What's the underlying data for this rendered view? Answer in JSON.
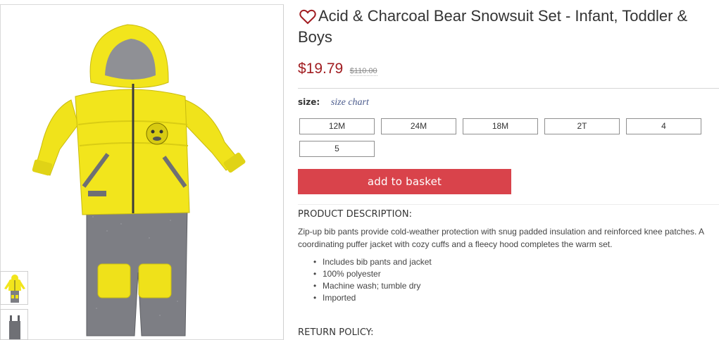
{
  "product": {
    "title": "Acid & Charcoal Bear Snowsuit Set - Infant, Toddler & Boys",
    "price": "$19.79",
    "original_price": "$110.00"
  },
  "size_selector": {
    "label": "size:",
    "chart_link": "size chart",
    "options": [
      "12M",
      "24M",
      "18M",
      "2T",
      "4",
      "5"
    ]
  },
  "actions": {
    "add_to_basket": "add to basket"
  },
  "description": {
    "heading": "PRODUCT DESCRIPTION:",
    "text": "Zip-up bib pants provide cold-weather protection with snug padded insulation and reinforced knee patches. A coordinating puffer jacket with cozy cuffs and a fleecy hood completes the warm set.",
    "bullets": [
      "Includes bib pants and jacket",
      "100% polyester",
      "Machine wash; tumble dry",
      "Imported"
    ]
  },
  "return_policy": {
    "heading": "RETURN POLICY:"
  },
  "icons": {
    "favorite": "heart-outline-icon"
  },
  "colors": {
    "price": "#a11d21",
    "add_button": "#d9434b",
    "jacket_yellow": "#f2e51c",
    "pants_gray": "#7a7b80"
  }
}
